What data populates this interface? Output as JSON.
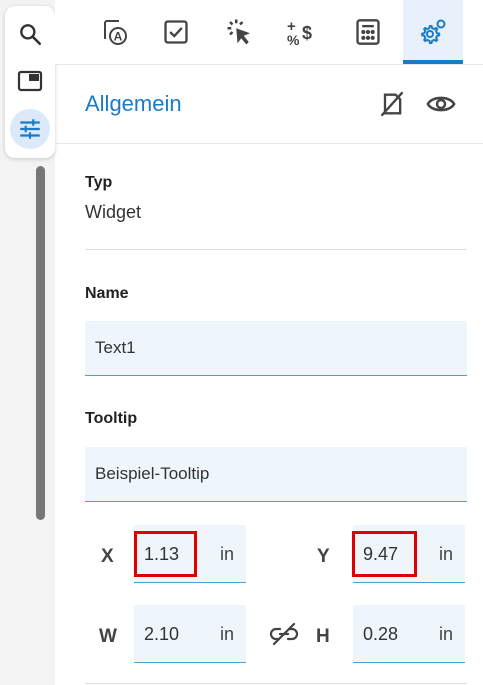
{
  "rail": {
    "items": [
      {
        "icon": "search-icon"
      },
      {
        "icon": "window-icon"
      },
      {
        "icon": "tune-icon",
        "active": true
      }
    ]
  },
  "toolbar": {
    "items": [
      {
        "icon": "text-field-icon"
      },
      {
        "icon": "checkbox-icon"
      },
      {
        "icon": "click-icon"
      },
      {
        "icon": "calculation-icon"
      },
      {
        "icon": "calculator-icon"
      },
      {
        "icon": "gear-icon",
        "active": true
      }
    ],
    "accent": "#1a7bc8"
  },
  "panel": {
    "title": "Allgemein",
    "type_label": "Typ",
    "type_value": "Widget",
    "name_label": "Name",
    "name_value": "Text1",
    "tooltip_label": "Tooltip",
    "tooltip_value": "Beispiel-Tooltip",
    "geometry": {
      "x_label": "X",
      "x_value": "1.13",
      "x_unit": "in",
      "y_label": "Y",
      "y_value": "9.47",
      "y_unit": "in",
      "w_label": "W",
      "w_value": "2.10",
      "w_unit": "in",
      "h_label": "H",
      "h_value": "0.28",
      "h_unit": "in"
    }
  },
  "colors": {
    "accent": "#1a7bc8",
    "highlight": "#e10000",
    "field_bg": "#eef5fb"
  }
}
